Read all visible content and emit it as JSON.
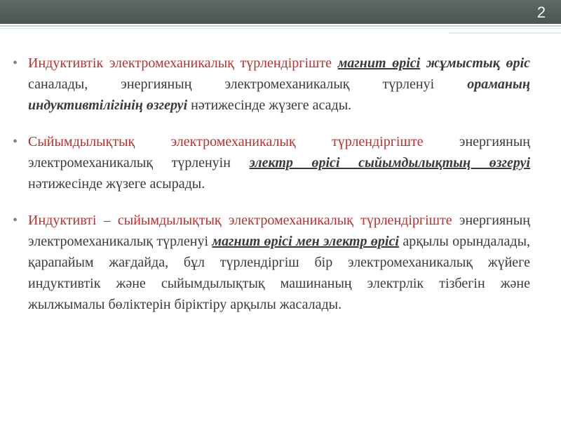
{
  "slide": {
    "number": "2"
  },
  "paragraphs": [
    {
      "segments": [
        {
          "text": "Индуктивтік электромеханикалық түрлендіргіште ",
          "style": "accent"
        },
        {
          "text": "магнит өрісі",
          "style": "emph-u"
        },
        {
          "text": " ",
          "style": "body"
        },
        {
          "text": "жұмыстық өріс",
          "style": "emph"
        },
        {
          "text": " саналады, энергияның электромеханикалық түрленуі ",
          "style": "body"
        },
        {
          "text": "ораманың индуктивтілігінің өзгеруі",
          "style": "emph"
        },
        {
          "text": " нәтижесінде жүзеге асады.",
          "style": "body"
        }
      ]
    },
    {
      "segments": [
        {
          "text": "Сыйымдылықтық электромеханикалық түрлендіргіште ",
          "style": "accent"
        },
        {
          "text": "энергияның электромеханикалық түрленуін ",
          "style": "body"
        },
        {
          "text": "электр өрісі сыйымдылықтың өзгеруі",
          "style": "emph-u"
        },
        {
          "text": " нәтижесінде жүзеге асырады.",
          "style": "body"
        }
      ]
    },
    {
      "segments": [
        {
          "text": "Индуктивті – сыйымдылықтық электромеханикалық түрлендіргіште ",
          "style": "accent"
        },
        {
          "text": "энергияның электромеханикалық түрленуі ",
          "style": "body"
        },
        {
          "text": "магнит өрісі мен электр өрісі",
          "style": "emph-u"
        },
        {
          "text": " арқылы орындалады, қарапайым жағдайда, бұл түрлендіргіш бір электромеханикалық жүйеге индуктивтік және сыйымдылықтық машинаның электрлік тізбегін және жылжымалы бөліктерін біріктіру арқылы жасалады.",
          "style": "body"
        }
      ]
    }
  ]
}
